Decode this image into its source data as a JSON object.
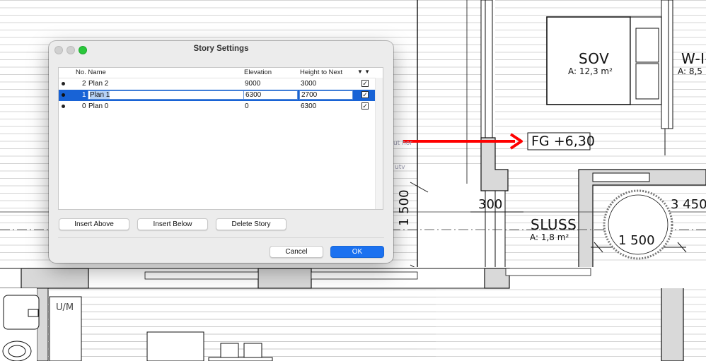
{
  "drawing": {
    "room_sov": {
      "name": "SOV",
      "area": "A: 12,3 m²"
    },
    "room_w": {
      "name": "W-I-",
      "area": "A: 8,5"
    },
    "room_sluss": {
      "name": "SLUSS",
      "area": "A: 1,8 m²"
    },
    "floor_marker": "FG +6,30",
    "dim_300": "300",
    "dim_3450": "3 450",
    "dim_1500_h": "1 500",
    "dim_1500_v": "1 500",
    "um_label": "U/M",
    "faint_label_1": "ut hor",
    "faint_label_2": "utv",
    "annotation_color": "#ff0000"
  },
  "dialog": {
    "title": "Story Settings",
    "columns": {
      "no_name": "No. Name",
      "elevation": "Elevation",
      "height_to_next": "Height to Next",
      "show_col": "▼ ▼"
    },
    "rows": [
      {
        "no": "2",
        "name": "Plan 2",
        "elevation": "9000",
        "height": "3000",
        "checked": true,
        "selected": false
      },
      {
        "no": "1",
        "name": "Plan 1",
        "elevation": "6300",
        "height": "2700",
        "checked": true,
        "selected": true
      },
      {
        "no": "0",
        "name": "Plan 0",
        "elevation": "0",
        "height": "6300",
        "checked": true,
        "selected": false
      }
    ],
    "buttons": {
      "insert_above": "Insert Above",
      "insert_below": "Insert Below",
      "delete_story": "Delete Story",
      "cancel": "Cancel",
      "ok": "OK"
    },
    "selection_color": "#1863d6",
    "accent_color": "#1b71f0"
  }
}
